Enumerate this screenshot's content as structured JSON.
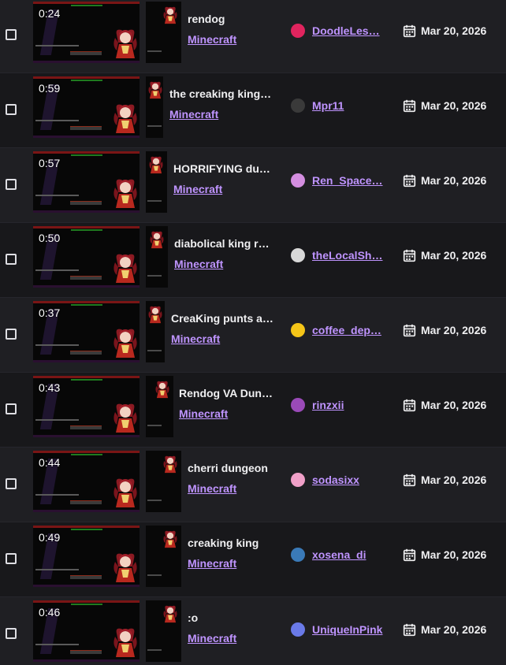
{
  "colors": {
    "accent_link": "#bf94ff",
    "row_dark": "#18181b",
    "row_light": "#1f1f23",
    "text": "#efeff1"
  },
  "clips": [
    {
      "duration": "0:24",
      "title": "rendog",
      "game": "Minecraft",
      "creator": "DoodleLes…",
      "creator_avatar_color": "#e0245e",
      "date": "Mar 20, 2026",
      "date_icon": "calendar-icon"
    },
    {
      "duration": "0:59",
      "title": "the creaking king…",
      "game": "Minecraft",
      "creator": "Mpr11",
      "creator_avatar_color": "#3a3a3a",
      "date": "Mar 20, 2026",
      "date_icon": "calendar-icon"
    },
    {
      "duration": "0:57",
      "title": "HORRIFYING du…",
      "game": "Minecraft",
      "creator": "Ren_Space…",
      "creator_avatar_color": "#d48ee0",
      "date": "Mar 20, 2026",
      "date_icon": "calendar-icon"
    },
    {
      "duration": "0:50",
      "title": "diabolical king r…",
      "game": "Minecraft",
      "creator": "theLocalSh…",
      "creator_avatar_color": "#d8d8d8",
      "date": "Mar 20, 2026",
      "date_icon": "calendar-icon"
    },
    {
      "duration": "0:37",
      "title": "CreaKing punts a…",
      "game": "Minecraft",
      "creator": "coffee_dep…",
      "creator_avatar_color": "#f5c518",
      "date": "Mar 20, 2026",
      "date_icon": "calendar-icon"
    },
    {
      "duration": "0:43",
      "title": "Rendog VA Dun…",
      "game": "Minecraft",
      "creator": "rinzxii",
      "creator_avatar_color": "#9a4ab8",
      "date": "Mar 20, 2026",
      "date_icon": "calendar-icon"
    },
    {
      "duration": "0:44",
      "title": "cherri dungeon",
      "game": "Minecraft",
      "creator": "sodasixx",
      "creator_avatar_color": "#f0a0c8",
      "date": "Mar 20, 2026",
      "date_icon": "calendar-icon"
    },
    {
      "duration": "0:49",
      "title": "creaking king",
      "game": "Minecraft",
      "creator": "xosena_di",
      "creator_avatar_color": "#3a7ab8",
      "date": "Mar 20, 2026",
      "date_icon": "calendar-icon"
    },
    {
      "duration": "0:46",
      "title": ":o",
      "game": "Minecraft",
      "creator": "UniqueInPink",
      "creator_avatar_color": "#6a7ae8",
      "date": "Mar 20, 2026",
      "date_icon": "calendar-icon"
    }
  ]
}
